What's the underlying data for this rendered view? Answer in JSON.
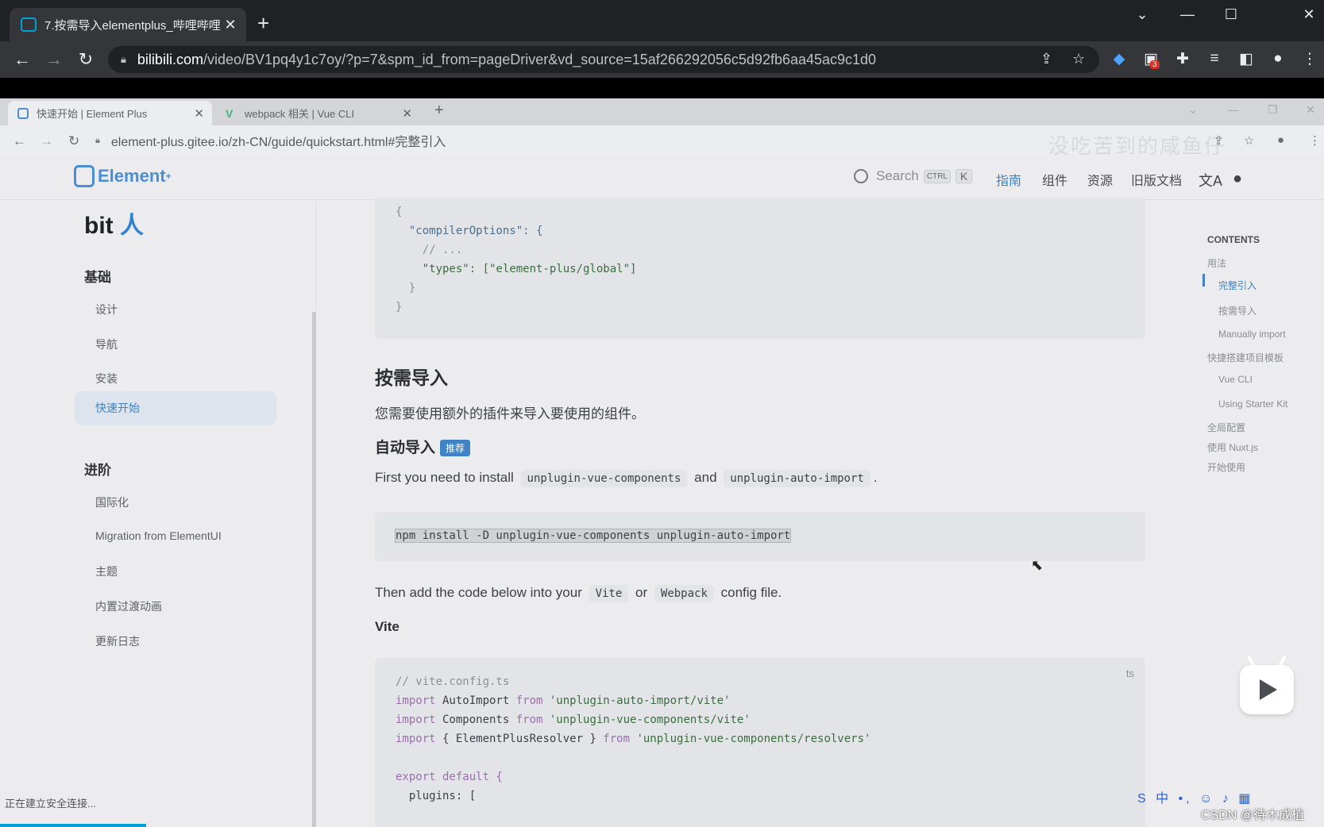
{
  "outer_browser": {
    "tab_title": "7.按需导入elementplus_哔哩哔哩",
    "url_host": "bilibili.com",
    "url_path": "/video/BV1pq4y1c7oy/?p=7&spm_id_from=pageDriver&vd_source=15af266292056c5d92fb6aa45ac9c1d0",
    "extension_badge": "3"
  },
  "inner_browser": {
    "tabs": [
      {
        "label": "快速开始 | Element Plus"
      },
      {
        "label": "webpack 相关 | Vue CLI"
      }
    ],
    "url": "element-plus.gitee.io/zh-CN/guide/quickstart.html#完整引入",
    "watermark": "没吃苦到的咸鱼仔"
  },
  "site": {
    "logo_text": "Element",
    "logo_sup": "+",
    "search_label": "Search",
    "search_kbd_ctrl": "CTRL",
    "search_kbd_k": "K",
    "nav": [
      "指南",
      "组件",
      "资源",
      "旧版文档"
    ],
    "translate_icon": "文A"
  },
  "sidebar": {
    "brand_main": "bit",
    "brand_accent": "人",
    "group_basic": "基础",
    "basic_items": [
      "设计",
      "导航",
      "安装",
      "快速开始"
    ],
    "group_advanced": "进阶",
    "advanced_items": [
      "国际化",
      "Migration from ElementUI",
      "主题",
      "内置过渡动画",
      "更新日志"
    ]
  },
  "content": {
    "tsconfig_lines": [
      "{",
      "  \"compilerOptions\": {",
      "    // ...",
      "    \"types\": [\"element-plus/global\"]",
      "  }",
      "}"
    ],
    "h2_on_demand": "按需导入",
    "p_on_demand": "您需要使用额外的插件来导入要使用的组件。",
    "h3_auto": "自动导入",
    "tag_recommended": "推荐",
    "p_install_prefix": "First you need to install",
    "code_pkg1": "unplugin-vue-components",
    "p_and": "and",
    "code_pkg2": "unplugin-auto-import",
    "p_install_suffix": ".",
    "npm_cmd": "npm install -D unplugin-vue-components unplugin-auto-import",
    "p_then_prefix": "Then add the code below into your",
    "code_vite": "Vite",
    "p_or": "or",
    "code_webpack": "Webpack",
    "p_then_suffix": "config file.",
    "h4_vite": "Vite",
    "vite_lang": "ts",
    "vite_code": {
      "comment": "// vite.config.ts",
      "l1_kw": "import",
      "l1_name": " AutoImport ",
      "l1_from": "from",
      "l1_str": " 'unplugin-auto-import/vite'",
      "l2_kw": "import",
      "l2_name": " Components ",
      "l2_from": "from",
      "l2_str": " 'unplugin-vue-components/vite'",
      "l3_kw": "import",
      "l3_name": " { ElementPlusResolver } ",
      "l3_from": "from",
      "l3_str": " 'unplugin-vue-components/resolvers'",
      "l5": "export default {",
      "l6": "  plugins: ["
    }
  },
  "toc": {
    "title": "CONTENTS",
    "items": [
      "用法",
      "完整引入",
      "按需导入",
      "Manually import",
      "快捷搭建项目模板",
      "Vue CLI",
      "Using Starter Kit",
      "全局配置",
      "使用 Nuxt.js",
      "开始使用"
    ]
  },
  "status_text": "正在建立安全连接...",
  "csdn_watermark": "CSDN @待木成植",
  "colors": {
    "accent": "#3f83c6",
    "bilibili": "#00a1d6"
  }
}
